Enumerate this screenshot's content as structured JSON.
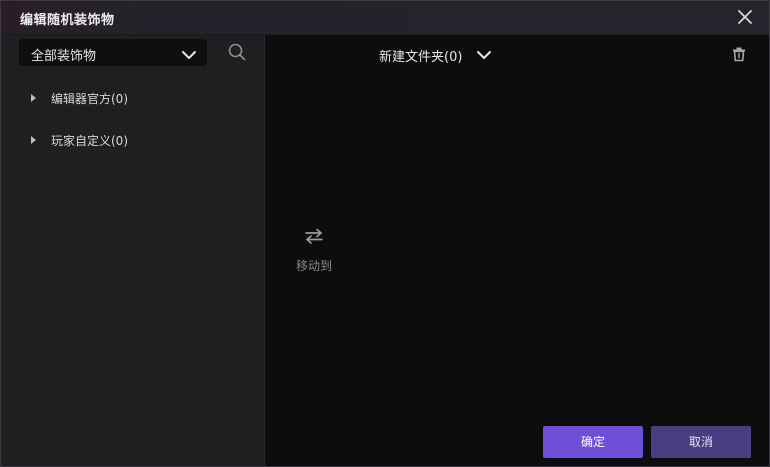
{
  "dialog": {
    "title": "编辑随机装饰物"
  },
  "left_panel": {
    "category_select": {
      "value": "全部装饰物"
    },
    "tree": [
      {
        "label": "编辑器官方(0)"
      },
      {
        "label": "玩家自定义(0)"
      }
    ]
  },
  "right_panel": {
    "folder_select": {
      "value": "新建文件夹(0)"
    },
    "move_to": {
      "label": "移动到"
    }
  },
  "footer": {
    "confirm_label": "确定",
    "cancel_label": "取消"
  },
  "icons": {
    "close": "close-icon",
    "search": "search-icon",
    "chevron": "chevron-down-icon",
    "trash": "trash-icon",
    "swap": "swap-arrows-icon"
  },
  "colors": {
    "accent": "#6d50d6",
    "cancel": "#4a3d80"
  }
}
